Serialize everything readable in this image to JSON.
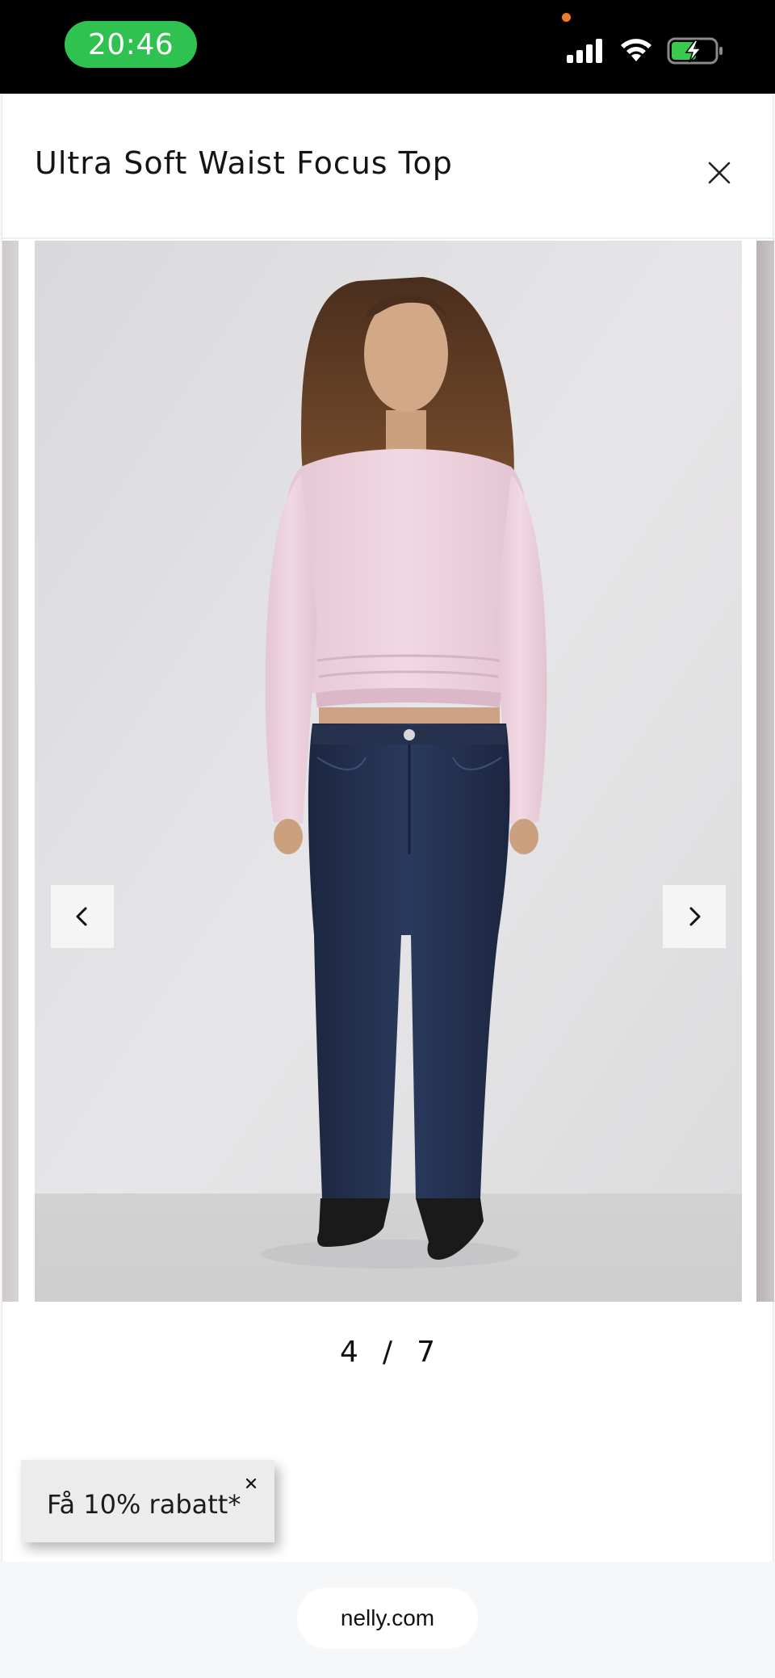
{
  "status_bar": {
    "time": "20:46",
    "icons": [
      "signal-icon",
      "wifi-icon",
      "battery-charging-icon"
    ],
    "colors": {
      "time_pill": "#2fc250",
      "privacy_dot": "#f07a2a",
      "battery_fill": "#3ac94f"
    }
  },
  "modal": {
    "title": "Ultra Soft Waist Focus Top",
    "close_icon": "close-icon"
  },
  "gallery": {
    "current_index": "4",
    "separator": "/",
    "total": "7",
    "prev_icon": "chevron-left-icon",
    "next_icon": "chevron-right-icon"
  },
  "discount_toast": {
    "label": "Få 10% rabatt*",
    "close_glyph": "×"
  },
  "browser": {
    "url": "nelly.com"
  }
}
